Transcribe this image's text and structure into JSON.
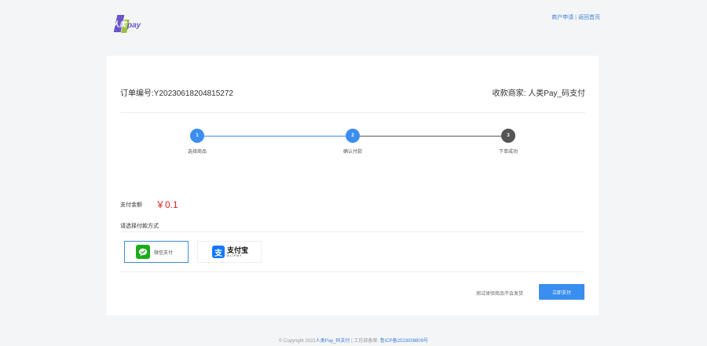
{
  "header": {
    "logo": {
      "cn": "人类",
      "en": "pay"
    },
    "links": {
      "merchant_apply": "商户申请",
      "back_home": "返回首页",
      "separator": "|"
    }
  },
  "order": {
    "order_no": "订单编号:Y20230618204815272",
    "merchant": "收款商家: 人类Pay_码支付"
  },
  "steps": [
    {
      "num": "1",
      "label": "选择商品",
      "color": "#3a8ef0"
    },
    {
      "num": "2",
      "label": "确认付款",
      "color": "#3a8ef0"
    },
    {
      "num": "3",
      "label": "下单成功",
      "color": "#555555"
    }
  ],
  "payment": {
    "amount_label": "支付金额",
    "amount": "￥0.1",
    "method_label": "请选择付款方式",
    "methods": [
      {
        "label": "微信支付",
        "selected": true
      },
      {
        "label_cn": "支付宝",
        "label_en": "ALIPAY",
        "icon_char": "支",
        "selected": false
      }
    ],
    "note": "测试体验商品不会发货",
    "pay_button": "立即支付"
  },
  "footer": {
    "copyright": "© Copyright 2022",
    "site_link": "人类Pay_码支付",
    "separator": "|",
    "icp_label": "工信部备案:",
    "icp_link": "鲁ICP备2023008809号"
  },
  "colors": {
    "accent": "#3a8ef0",
    "amount_red": "#e2231a",
    "wechat_green": "#1aad19",
    "alipay_blue": "#1677ff"
  }
}
